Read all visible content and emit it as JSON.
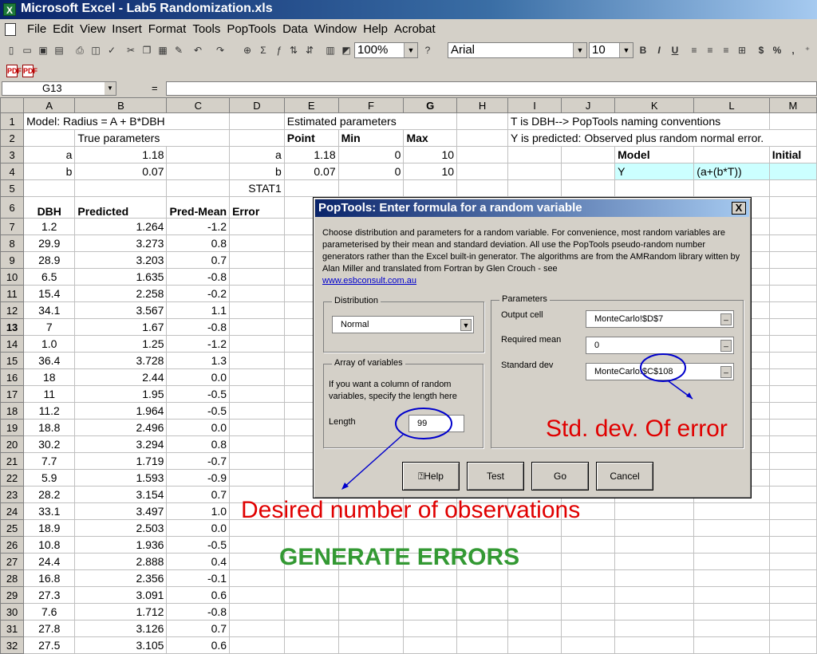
{
  "window": {
    "title": "Microsoft Excel - Lab5 Randomization.xls",
    "app_icon": "excel-icon"
  },
  "menu": [
    "File",
    "Edit",
    "View",
    "Insert",
    "Format",
    "Tools",
    "PopTools",
    "Data",
    "Window",
    "Help",
    "Acrobat"
  ],
  "toolbar": {
    "zoom": "100%",
    "font": "Arial",
    "font_size": "10",
    "bold": "B",
    "italic": "I",
    "underline": "U",
    "currency": "$",
    "percent": "%",
    "comma": ","
  },
  "formula_bar": {
    "name_box": "G13",
    "equals": "=",
    "formula": ""
  },
  "columns": [
    "A",
    "B",
    "C",
    "D",
    "E",
    "F",
    "G",
    "H",
    "I",
    "J",
    "K",
    "L",
    "M"
  ],
  "rows": {
    "r1": {
      "A": "Model:  Radius = A + B*DBH",
      "E": "Estimated parameters",
      "I": "T is DBH--> PopTools naming conventions"
    },
    "r2": {
      "B": "True parameters",
      "I": "Y is predicted: Observed plus random normal error."
    },
    "r3": {
      "A": "a",
      "B": "1.18",
      "D": "a",
      "E": "1.18",
      "F": "0",
      "G": "10",
      "K": "Model",
      "M": "Initial"
    },
    "r4": {
      "A": "b",
      "B": "0.07",
      "D": "b",
      "E": "0.07",
      "F": "0",
      "G": "10",
      "K": "Y",
      "L": "(a+(b*T))"
    },
    "r5": {
      "D": "STAT1"
    },
    "e_headers": {
      "E": "Point",
      "F": "Min",
      "G": "Max"
    },
    "r6": {
      "A": "DBH",
      "B": "Predicted",
      "C": "Pred-Mean",
      "D": "Error"
    }
  },
  "data_rows": [
    {
      "n": "7",
      "dbh": "1.2",
      "pred": "1.264",
      "pm": "-1.2"
    },
    {
      "n": "8",
      "dbh": "29.9",
      "pred": "3.273",
      "pm": "0.8"
    },
    {
      "n": "9",
      "dbh": "28.9",
      "pred": "3.203",
      "pm": "0.7"
    },
    {
      "n": "10",
      "dbh": "6.5",
      "pred": "1.635",
      "pm": "-0.8"
    },
    {
      "n": "11",
      "dbh": "15.4",
      "pred": "2.258",
      "pm": "-0.2"
    },
    {
      "n": "12",
      "dbh": "34.1",
      "pred": "3.567",
      "pm": "1.1"
    },
    {
      "n": "13",
      "dbh": "7",
      "pred": "1.67",
      "pm": "-0.8"
    },
    {
      "n": "14",
      "dbh": "1.0",
      "pred": "1.25",
      "pm": "-1.2"
    },
    {
      "n": "15",
      "dbh": "36.4",
      "pred": "3.728",
      "pm": "1.3"
    },
    {
      "n": "16",
      "dbh": "18",
      "pred": "2.44",
      "pm": "0.0"
    },
    {
      "n": "17",
      "dbh": "11",
      "pred": "1.95",
      "pm": "-0.5"
    },
    {
      "n": "18",
      "dbh": "11.2",
      "pred": "1.964",
      "pm": "-0.5"
    },
    {
      "n": "19",
      "dbh": "18.8",
      "pred": "2.496",
      "pm": "0.0"
    },
    {
      "n": "20",
      "dbh": "30.2",
      "pred": "3.294",
      "pm": "0.8"
    },
    {
      "n": "21",
      "dbh": "7.7",
      "pred": "1.719",
      "pm": "-0.7"
    },
    {
      "n": "22",
      "dbh": "5.9",
      "pred": "1.593",
      "pm": "-0.9"
    },
    {
      "n": "23",
      "dbh": "28.2",
      "pred": "3.154",
      "pm": "0.7"
    },
    {
      "n": "24",
      "dbh": "33.1",
      "pred": "3.497",
      "pm": "1.0"
    },
    {
      "n": "25",
      "dbh": "18.9",
      "pred": "2.503",
      "pm": "0.0"
    },
    {
      "n": "26",
      "dbh": "10.8",
      "pred": "1.936",
      "pm": "-0.5"
    },
    {
      "n": "27",
      "dbh": "24.4",
      "pred": "2.888",
      "pm": "0.4"
    },
    {
      "n": "28",
      "dbh": "16.8",
      "pred": "2.356",
      "pm": "-0.1"
    },
    {
      "n": "29",
      "dbh": "27.3",
      "pred": "3.091",
      "pm": "0.6"
    },
    {
      "n": "30",
      "dbh": "7.6",
      "pred": "1.712",
      "pm": "-0.8"
    },
    {
      "n": "31",
      "dbh": "27.8",
      "pred": "3.126",
      "pm": "0.7"
    },
    {
      "n": "32",
      "dbh": "27.5",
      "pred": "3.105",
      "pm": "0.6"
    }
  ],
  "dialog": {
    "title": "PopTools: Enter formula for a random variable",
    "close": "X",
    "description": "Choose distribution and parameters for a random variable. For convenience, most random variables are parameterised by their mean and standard deviation. All use the PopTools pseudo-random number generators rather than the Excel built-in generator. The algorithms are from the AMRandom library witten by Alan Miller and translated from Fortran by Glen Crouch - see",
    "link": "www.esbconsult.com.au",
    "distribution_legend": "Distribution",
    "distribution_value": "Normal",
    "array_legend": "Array of variables",
    "array_text": "If you want a column of random variables, specify the length here",
    "length_label": "Length",
    "length_value": "99",
    "parameters_legend": "Parameters",
    "output_label": "Output cell",
    "output_value": "MonteCarlo!$D$7",
    "mean_label": "Required mean",
    "mean_value": "0",
    "sd_label": "Standard dev",
    "sd_value": "MonteCarlo!$C$108",
    "buttons": {
      "help": "Help",
      "test": "Test",
      "go": "Go",
      "cancel": "Cancel"
    }
  },
  "annotations": {
    "std_dev": "Std. dev. Of error",
    "desired": "Desired number of observations",
    "generate": "GENERATE ERRORS",
    "accent_red": "#e00000",
    "accent_green": "#339933",
    "circle_color": "#0000cc"
  }
}
